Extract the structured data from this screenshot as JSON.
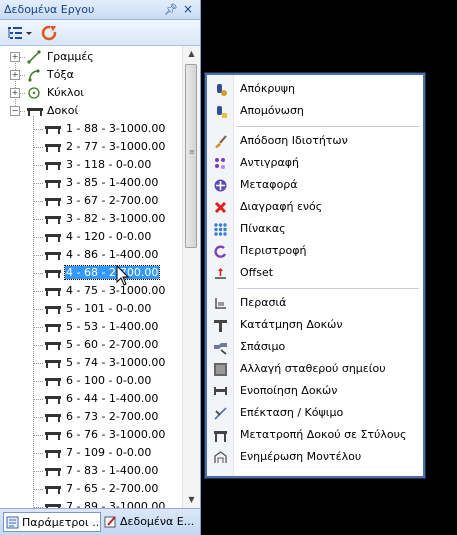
{
  "panel": {
    "title": "Δεδομένα Εργου",
    "pin_glyph": "ᵖ",
    "close_glyph": "×",
    "toolbar": {
      "icons": [
        "list-filter-icon",
        "dropdown-arrow-icon",
        "refresh-icon"
      ]
    },
    "tree": {
      "groups": [
        {
          "label": "Γραμμές",
          "icon": "line-icon",
          "expanded": false
        },
        {
          "label": "Τόξα",
          "icon": "arc-icon",
          "expanded": false
        },
        {
          "label": "Κύκλοι",
          "icon": "circle-icon",
          "expanded": false
        },
        {
          "label": "Δοκοί",
          "icon": "beam-icon",
          "expanded": true
        }
      ],
      "beams": [
        "1 - 88 - 3-1000.00",
        "2 - 77 - 3-1000.00",
        "3 - 118 - 0-0.00",
        "3 - 85 - 1-400.00",
        "3 - 67 - 2-700.00",
        "3 - 82 - 3-1000.00",
        "4 - 120 - 0-0.00",
        "4 - 86 - 1-400.00",
        "4 - 68 - 2-700.00",
        "4 - 75 - 3-1000.00",
        "5 - 101 - 0-0.00",
        "5 - 53 - 1-400.00",
        "5 - 60 - 2-700.00",
        "5 - 74 - 3-1000.00",
        "6 - 100 - 0-0.00",
        "6 - 44 - 1-400.00",
        "6 - 73 - 2-700.00",
        "6 - 76 - 3-1000.00",
        "7 - 109 - 0-0.00",
        "7 - 83 - 1-400.00",
        "7 - 65 - 2-700.00",
        "7 - 89 - 3-1000.00"
      ],
      "selected_index": 8
    },
    "bottom_tabs": [
      {
        "label": "Παράμετροι ...",
        "icon": "parameters-icon",
        "active": true
      },
      {
        "label": "Δεδομένα Ε...",
        "icon": "project-data-icon",
        "active": false
      }
    ]
  },
  "menu": {
    "items": [
      {
        "label": "Απόκρυψη",
        "icon": "hide-icon",
        "group": 0
      },
      {
        "label": "Απομόνωση",
        "icon": "isolate-icon",
        "group": 0
      },
      {
        "label": "Απόδοση Ιδιοτήτων",
        "icon": "brush-icon",
        "group": 1
      },
      {
        "label": "Αντιγραφή",
        "icon": "copy-icon",
        "group": 1
      },
      {
        "label": "Μεταφορά",
        "icon": "move-icon",
        "group": 1
      },
      {
        "label": "Διαγραφή ενός",
        "icon": "delete-icon",
        "group": 1
      },
      {
        "label": "Πίνακας",
        "icon": "array-icon",
        "group": 1
      },
      {
        "label": "Περιστροφή",
        "icon": "rotate-icon",
        "group": 1
      },
      {
        "label": "Offset",
        "icon": "offset-icon",
        "group": 1
      },
      {
        "label": "Περασιά",
        "icon": "alignment-icon",
        "group": 2
      },
      {
        "label": "Κατάτμηση Δοκών",
        "icon": "split-beam-icon",
        "group": 2
      },
      {
        "label": "Σπάσιμο",
        "icon": "break-icon",
        "group": 2
      },
      {
        "label": "Αλλαγή σταθερού σημείου",
        "icon": "fixed-point-icon",
        "group": 2
      },
      {
        "label": "Ενοποίηση Δοκών",
        "icon": "merge-beams-icon",
        "group": 2
      },
      {
        "label": "Επέκταση / Κόψιμο",
        "icon": "extend-trim-icon",
        "group": 2
      },
      {
        "label": "Μετατροπή Δοκού σε Στύλους",
        "icon": "convert-column-icon",
        "group": 2
      },
      {
        "label": "Ενημέρωση Μοντέλου",
        "icon": "update-model-icon",
        "group": 2
      }
    ]
  },
  "colors": {
    "selection": "#3399ff",
    "panel_border": "#7da2ce",
    "menu_border": "#4d6fa8",
    "title_text": "#15428b"
  }
}
